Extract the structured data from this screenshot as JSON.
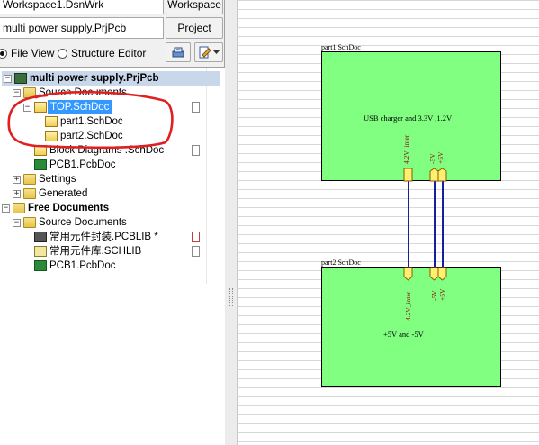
{
  "toolbar": {
    "workspace_field": "Workspace1.DsnWrk",
    "workspace_button": "Workspace",
    "project_field": "multi power supply.PrjPcb",
    "project_button": "Project"
  },
  "view_options": {
    "file_view": "File View",
    "structure_editor": "Structure Editor",
    "selected": "File View"
  },
  "tree": {
    "project": "multi power supply.PrjPcb",
    "source_documents": "Source Documents",
    "top": "TOP.SchDoc",
    "part1": "part1.SchDoc",
    "part2": "part2.SchDoc",
    "block_diagrams": "Block Diagrams .SchDoc",
    "pcb1": "PCB1.PcbDoc",
    "settings": "Settings",
    "generated": "Generated",
    "free_documents": "Free Documents",
    "free_source_documents": "Source Documents",
    "pcblib": "常用元件封装.PCBLIB *",
    "schlib": "常用元件库.SCHLIB",
    "free_pcb1": "PCB1.PcbDoc"
  },
  "schematic": {
    "sheet1": {
      "label": "part1.SchDoc",
      "description": "USB charger and 3.3V ,1.2V",
      "ports": [
        "4.2V_inter",
        "-5V",
        "+5V"
      ]
    },
    "sheet2": {
      "label": "part2.SchDoc",
      "description": "+5V and -5V",
      "ports": [
        "4.2V_inter",
        "-5V",
        "+5V"
      ]
    },
    "sheet_fill_color": "#80ff80",
    "wire_color": "#1c1c9e",
    "annotation_color": "#e02020"
  }
}
